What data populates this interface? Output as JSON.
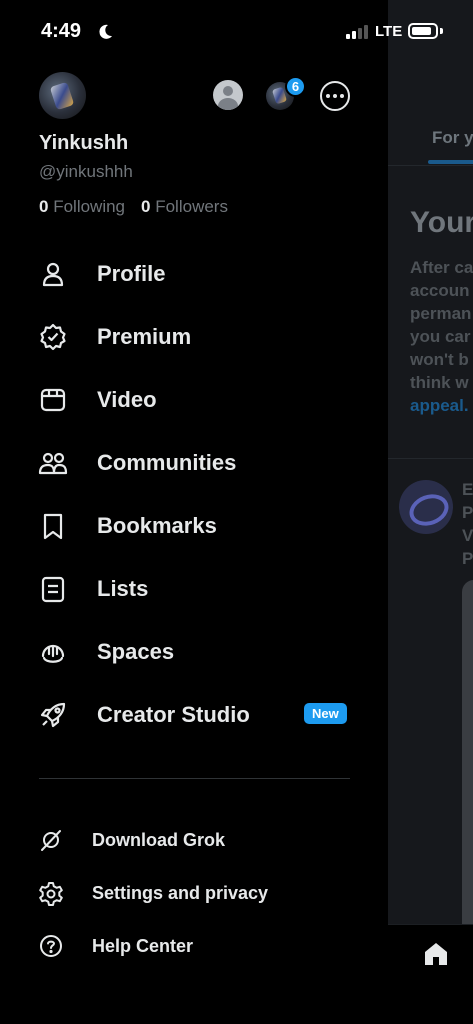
{
  "status_bar": {
    "time": "4:49",
    "network": "LTE",
    "battery_level": 0.85,
    "signal_bars_filled": 2,
    "signal_bars_total": 4
  },
  "profile": {
    "display_name": "Yinkushh",
    "handle": "@yinkushhh",
    "following_count": "0",
    "following_label": "Following",
    "followers_count": "0",
    "followers_label": "Followers",
    "notification_count": "6"
  },
  "menu": {
    "items": [
      {
        "label": "Profile",
        "icon": "person-icon"
      },
      {
        "label": "Premium",
        "icon": "verified-badge-icon"
      },
      {
        "label": "Video",
        "icon": "video-icon"
      },
      {
        "label": "Communities",
        "icon": "communities-icon"
      },
      {
        "label": "Bookmarks",
        "icon": "bookmark-icon"
      },
      {
        "label": "Lists",
        "icon": "list-icon"
      },
      {
        "label": "Spaces",
        "icon": "spaces-icon"
      },
      {
        "label": "Creator Studio",
        "icon": "rocket-icon",
        "badge": "New"
      }
    ],
    "secondary": [
      {
        "label": "Download Grok",
        "icon": "grok-icon"
      },
      {
        "label": "Settings and privacy",
        "icon": "gear-icon"
      },
      {
        "label": "Help Center",
        "icon": "help-icon"
      }
    ]
  },
  "background": {
    "tab_label": "For y",
    "heading": "Your",
    "paragraph_lines": [
      "After ca",
      "accoun",
      "perman",
      "you car",
      "won't b",
      "think w"
    ],
    "paragraph_link": "appeal.",
    "post_lines": [
      "E",
      "P",
      "V",
      "P"
    ]
  },
  "colors": {
    "accent": "#1d9bf0",
    "background": "#000000",
    "text_primary": "#e7e9ea",
    "text_secondary": "#71767b"
  }
}
